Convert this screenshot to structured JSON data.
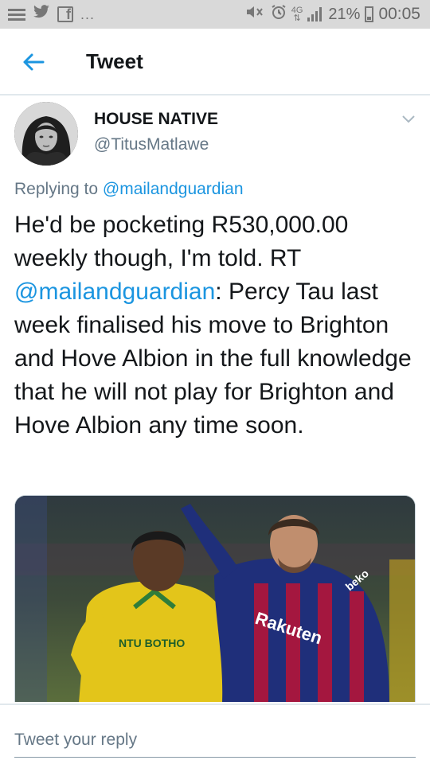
{
  "status_bar": {
    "left_icons": [
      "notification-lines-icon",
      "twitter-icon",
      "facebook-icon",
      "more-notifications-icon"
    ],
    "overflow_dots": "...",
    "network_label": "4G",
    "battery_percent": "21%",
    "time": "00:05"
  },
  "header": {
    "title": "Tweet",
    "back_icon": "arrow-left-icon"
  },
  "tweet": {
    "author_name": "HOUSE NATIVE",
    "author_handle": "@TitusMatlawe",
    "replying_prefix": "Replying to",
    "replying_to": "@mailandguardian",
    "text_part1": "He'd be pocketing R530,000.00 weekly though, I'm told. RT",
    "text_mention": "@mailandguardian",
    "text_part2": ": Percy Tau last week finalised his move to Brighton and Hove Albion in the full knowledge that he will not play for Brighton and Hove Albion any time soon.",
    "media": {
      "left_jersey_text": "NTU BOTHO",
      "right_jersey_text": "Rakuten",
      "sleeve_text": "beko"
    }
  },
  "reply": {
    "placeholder": "Tweet your reply"
  },
  "colors": {
    "link": "#1b95e0",
    "secondary_text": "#657786",
    "status_bar_bg": "#d9d9d9"
  }
}
